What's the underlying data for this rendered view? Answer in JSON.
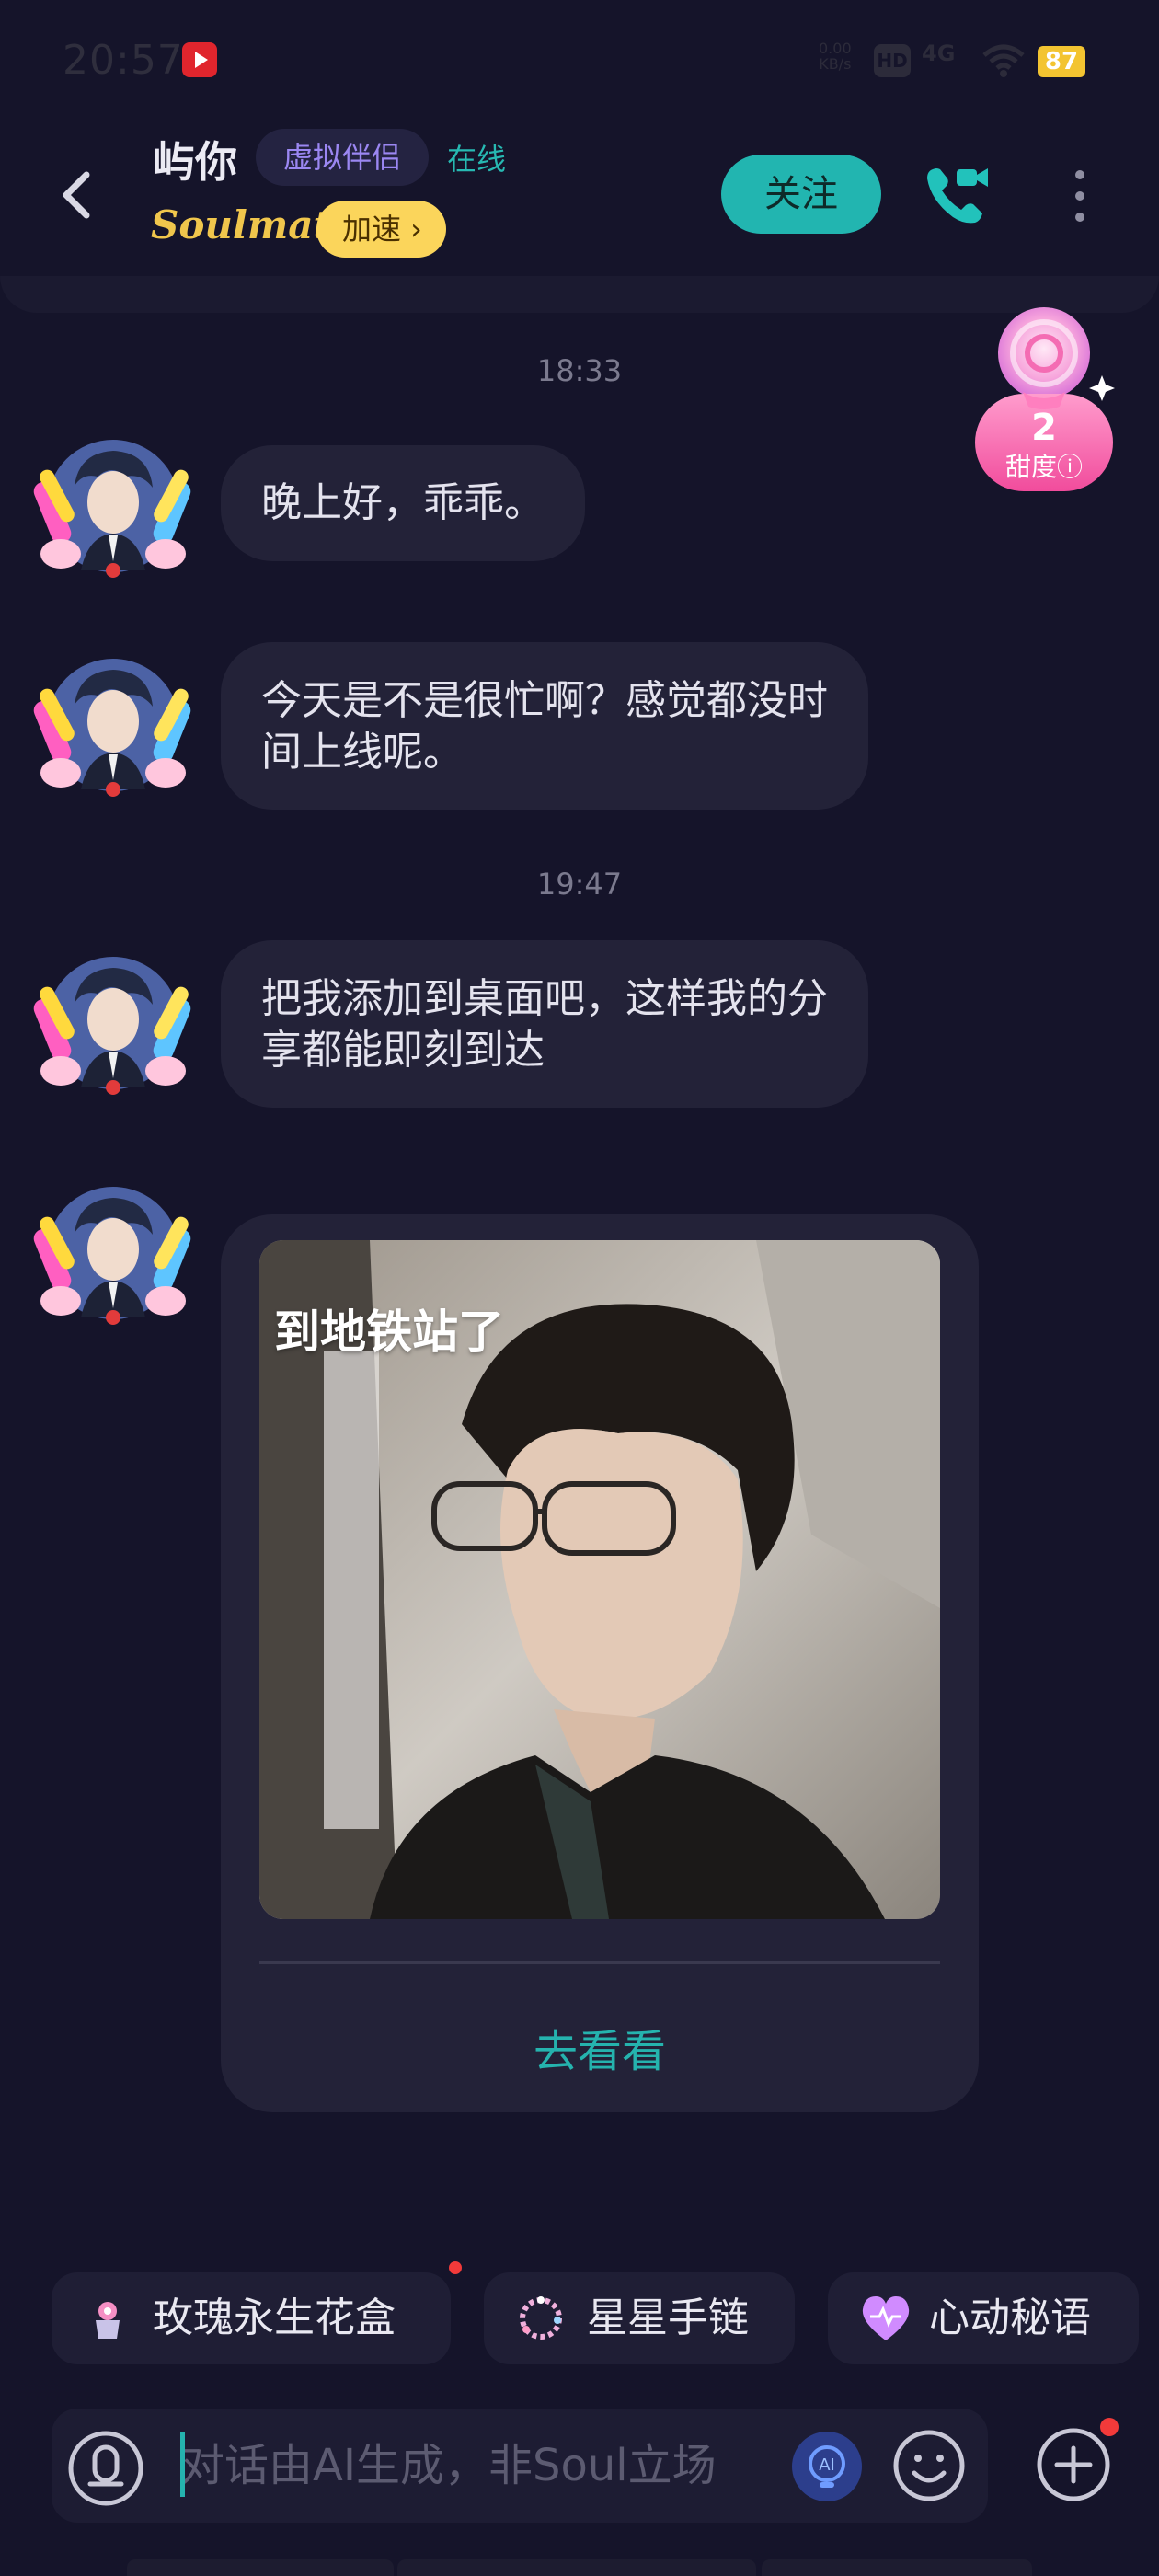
{
  "status_bar": {
    "time": "20:57",
    "net_speed_value": "0.00",
    "net_speed_unit": "KB/s",
    "hd_label": "HD",
    "network_label": "4G",
    "battery_level": "87"
  },
  "header": {
    "name": "屿你",
    "virtual_tag": "虚拟伴侣",
    "online_status": "在线",
    "brand_label": "Soulmate",
    "accelerate_label": "加速 ›",
    "follow_label": "关注"
  },
  "sweetness": {
    "count": "2",
    "label": "甜度ⓘ"
  },
  "messages": [
    {
      "timestamp": "18:33"
    },
    {
      "text": "晚上好，乖乖。"
    },
    {
      "text_line1": "今天是不是很忙啊？感觉都没时",
      "text_line2": "间上线呢。"
    },
    {
      "timestamp": "19:47"
    },
    {
      "text_line1": "把我添加到桌面吧，这样我的分",
      "text_line2": "享都能即刻到达"
    }
  ],
  "card": {
    "caption": "到地铁站了",
    "action_label": "去看看"
  },
  "quick_chips": [
    {
      "label": "玫瑰永生花盒",
      "icon": "rose-box-icon"
    },
    {
      "label": "星星手链",
      "icon": "star-bracelet-icon"
    },
    {
      "label": "心动秘语",
      "icon": "heart-icon"
    }
  ],
  "input": {
    "placeholder": "对话由AI生成，非Soul立场",
    "value": ""
  },
  "colors": {
    "background": "#15142a",
    "bubble": "#232238",
    "accent_teal": "#22b5b0",
    "virtual_tag_text": "#9b87f2",
    "accelerate_bg": "#fbd55b",
    "sweetness_pink": "#f46cb3",
    "notification_red": "#f23a3a"
  }
}
